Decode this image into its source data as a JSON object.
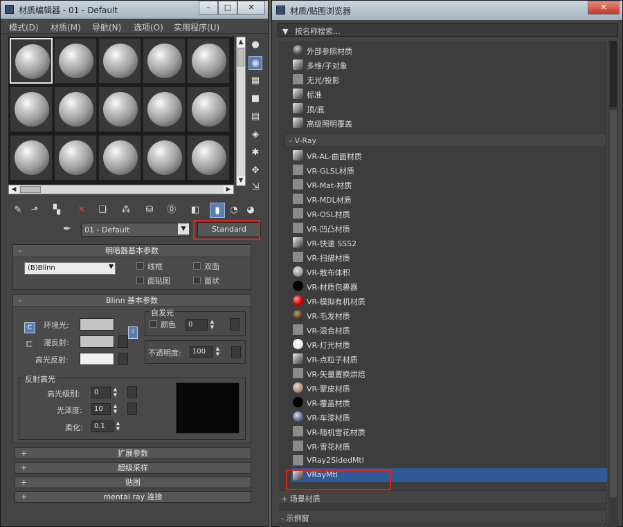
{
  "left_window": {
    "title": "材质编辑器 - 01 - Default",
    "menu": [
      "模式(D)",
      "材质(M)",
      "导航(N)",
      "选项(O)",
      "实用程序(U)"
    ],
    "material_name": "01 - Default",
    "material_type_button": "Standard",
    "shader_rollout": {
      "title": "明暗器基本参数",
      "shader": "(B)Blinn",
      "checkboxes": [
        "线框",
        "双面",
        "面贴图",
        "面状"
      ]
    },
    "blinn_rollout": {
      "title": "Blinn 基本参数",
      "self_illum_title": "自发光",
      "color_label": "颜色",
      "self_illum_value": "0",
      "opacity_label": "不透明度:",
      "opacity_value": "100",
      "ambient": "环境光:",
      "diffuse": "漫反射:",
      "specular": "高光反射:",
      "lock_label": "C",
      "highlight_title": "反射高光",
      "spec_level_label": "高光级别:",
      "spec_level_value": "0",
      "gloss_label": "光泽度:",
      "gloss_value": "10",
      "soften_label": "柔化:",
      "soften_value": "0.1"
    },
    "collapsed_rollouts": [
      "扩展参数",
      "超级采样",
      "贴图",
      "mental ray 连接"
    ],
    "colors": {
      "ambient": "#c4c4c4",
      "diffuse": "#c4c4c4",
      "specular": "#f0f0f0"
    }
  },
  "right_window": {
    "title": "材质/贴图浏览器",
    "search_placeholder": "按名称搜索...",
    "standard_items": [
      "外部参照材质",
      "多维/子对象",
      "无光/投影",
      "标准",
      "顶/底",
      "高级照明覆盖"
    ],
    "vray_category": "- V-Ray",
    "vray_items": [
      {
        "label": "VR-AL-曲面材质",
        "icon": "std"
      },
      {
        "label": "VR-GLSL材质",
        "icon": "flat"
      },
      {
        "label": "VR-Mat-材质",
        "icon": "flat"
      },
      {
        "label": "VR-MDL材质",
        "icon": "flat"
      },
      {
        "label": "VR-OSL材质",
        "icon": "flat"
      },
      {
        "label": "VR-凹凸材质",
        "icon": "flat"
      },
      {
        "label": "VR-快速 SSS2",
        "icon": "std"
      },
      {
        "label": "VR-扫描材质",
        "icon": "flat"
      },
      {
        "label": "VR-散布体积",
        "icon": "grey"
      },
      {
        "label": "VR-材质包裹器",
        "icon": "black"
      },
      {
        "label": "VR-模拟有机材质",
        "icon": "red"
      },
      {
        "label": "VR-毛发材质",
        "icon": "brown"
      },
      {
        "label": "VR-混合材质",
        "icon": "flat"
      },
      {
        "label": "VR-灯光材质",
        "icon": "white"
      },
      {
        "label": "VR-点粒子材质",
        "icon": "std"
      },
      {
        "label": "VR-矢量置换烘焙",
        "icon": "flat"
      },
      {
        "label": "VR-蒙皮材质",
        "icon": "pink"
      },
      {
        "label": "VR-覆盖材质",
        "icon": "black"
      },
      {
        "label": "VR-车漆材质",
        "icon": "car"
      },
      {
        "label": "VR-随机雪花材质",
        "icon": "flat"
      },
      {
        "label": "VR-雪花材质",
        "icon": "flat"
      },
      {
        "label": "VRay2SidedMtl",
        "icon": "flat"
      },
      {
        "label": "VRayMtl",
        "icon": "std"
      }
    ],
    "scene_category": "+ 场景材质",
    "sample_category": "- 示例窗"
  }
}
